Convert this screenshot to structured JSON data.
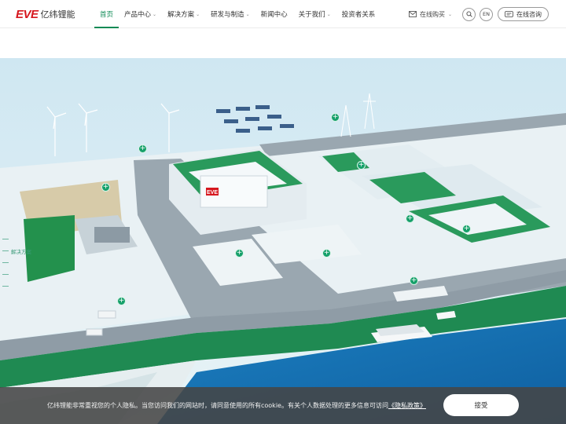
{
  "brand": {
    "mark": "EVE",
    "name": "亿纬锂能"
  },
  "nav": [
    {
      "label": "首页",
      "active": true,
      "dropdown": false
    },
    {
      "label": "产品中心",
      "dropdown": true
    },
    {
      "label": "解决方案",
      "dropdown": true
    },
    {
      "label": "研发与制造",
      "dropdown": true
    },
    {
      "label": "新闻中心",
      "dropdown": false
    },
    {
      "label": "关于我们",
      "dropdown": true
    },
    {
      "label": "投资者关系",
      "dropdown": false
    }
  ],
  "header_right": {
    "buy_label": "在线购买",
    "lang_label": "EN",
    "consult_label": "在线咨询"
  },
  "hero": {
    "side_label": "解决方案",
    "sign_text": "EVE"
  },
  "cookie": {
    "text": "亿纬锂能非常重视您的个人隐私。当您访问我们的网站时，请同意使用的所有cookie。有关个人数据处理的更多信息可访问",
    "link": "《隐私政策》",
    "accept_label": "接受"
  },
  "colors": {
    "accent": "#0e8a55",
    "brand_red": "#d6171e",
    "hotspot": "#16a06a"
  }
}
